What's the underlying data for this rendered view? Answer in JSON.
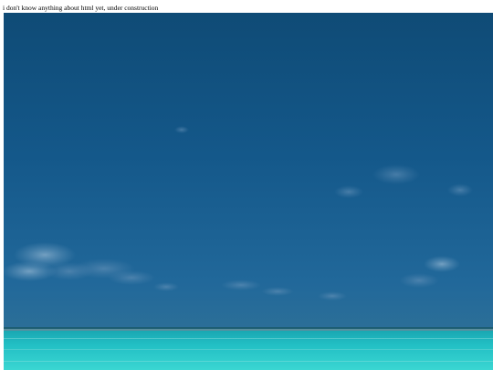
{
  "page": {
    "text": "i don't know anything about html yet, under construction"
  },
  "photo": {
    "subject": "ocean-horizon-photo",
    "colors": {
      "sky_top": "#114f7a",
      "sky_mid": "#155b88",
      "sky_bottom": "#2a6f99",
      "horizon_line": "#1e5f74",
      "sea_far": "#1fb6bd",
      "sea_near": "#35d1cf"
    }
  }
}
